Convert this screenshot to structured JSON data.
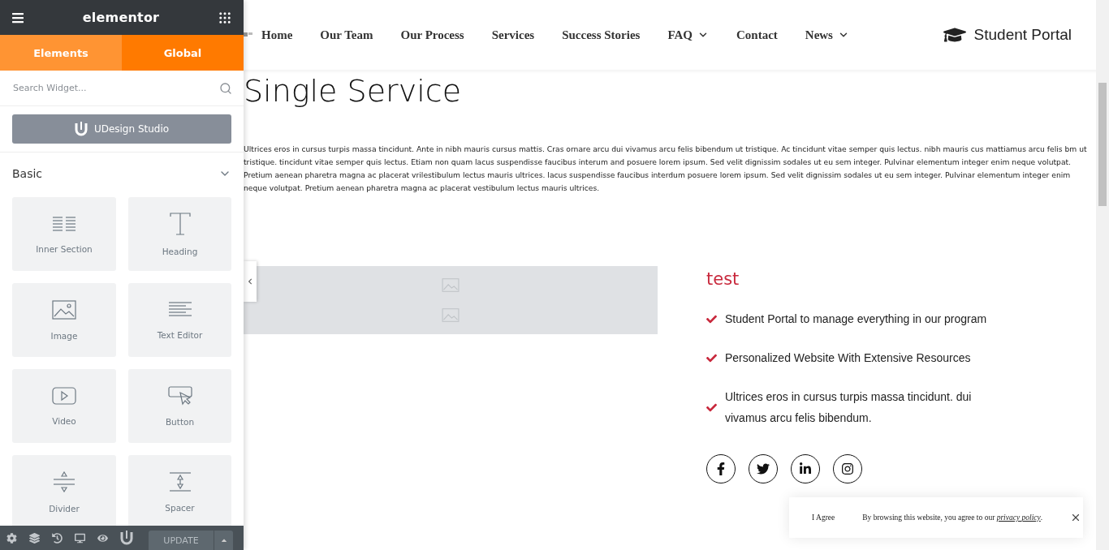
{
  "editor": {
    "logo": "elementor",
    "tabs": [
      {
        "label": "Elements",
        "selected": true
      },
      {
        "label": "Global",
        "selected": false
      }
    ],
    "search": {
      "placeholder": "Search Widget..."
    },
    "studio_button": "UDesign Studio",
    "section": {
      "title": "Basic",
      "expanded": true
    },
    "widgets": [
      {
        "kind": "inner-section",
        "label": "Inner Section"
      },
      {
        "kind": "heading",
        "label": "Heading"
      },
      {
        "kind": "image",
        "label": "Image"
      },
      {
        "kind": "text-editor",
        "label": "Text Editor"
      },
      {
        "kind": "video",
        "label": "Video"
      },
      {
        "kind": "button",
        "label": "Button"
      },
      {
        "kind": "divider",
        "label": "Divider"
      },
      {
        "kind": "spacer",
        "label": "Spacer"
      }
    ],
    "update_button": "UPDATE"
  },
  "page": {
    "nav": [
      {
        "label": "Home",
        "dropdown": false
      },
      {
        "label": "Our Team",
        "dropdown": false
      },
      {
        "label": "Our Process",
        "dropdown": false
      },
      {
        "label": "Services",
        "dropdown": false
      },
      {
        "label": "Success Stories",
        "dropdown": false
      },
      {
        "label": "FAQ",
        "dropdown": true
      },
      {
        "label": "Contact",
        "dropdown": false
      },
      {
        "label": "News",
        "dropdown": true
      }
    ],
    "portal_link": "Student Portal",
    "title": "Single Service",
    "intro": "Ultrices eros in cursus turpis massa tincidunt. Ante in nibh mauris cursus mattis. Cras ornare arcu dui vivamus arcu felis bibendum ut tristique. Ac tincidunt vitae semper quis lectus. nibh mauris cus mattiamus arcu felis bm ut tristique. tincidunt vitae semper quis lectus. Etiam non quam lacus suspendisse faucibus interum and posuere lorem ipsum. Sed velit dignissim sodales ut eu sem integer. Pulvinar elementum integer enim neque volutpat. Pretium aenean pharetra magna ac placerat vrilestibulum lectus mauris ultrices. lacus suspendisse faucibus interdum posuere lorem ipsum. Sed velit dignissim sodales ut eu sem integer. Pulvinar elementum integer enim neque volutpat. Pretium aenean pharetra magna ac placerat vestibulum lectus mauris ultrices.",
    "feature": {
      "title": "test",
      "items": [
        "Student Portal to manage everything in our program",
        "Personalized Website With Extensive Resources",
        "Ultrices eros in cursus turpis massa tincidunt. dui vivamus arcu felis bibendum."
      ]
    },
    "social": [
      {
        "kind": "facebook"
      },
      {
        "kind": "twitter"
      },
      {
        "kind": "linkedin"
      },
      {
        "kind": "instagram"
      }
    ]
  },
  "cookie_notice": {
    "agree": "I Agree",
    "text": "By browsing this website, you agree to our ",
    "link": "privacy policy",
    "end": "."
  }
}
